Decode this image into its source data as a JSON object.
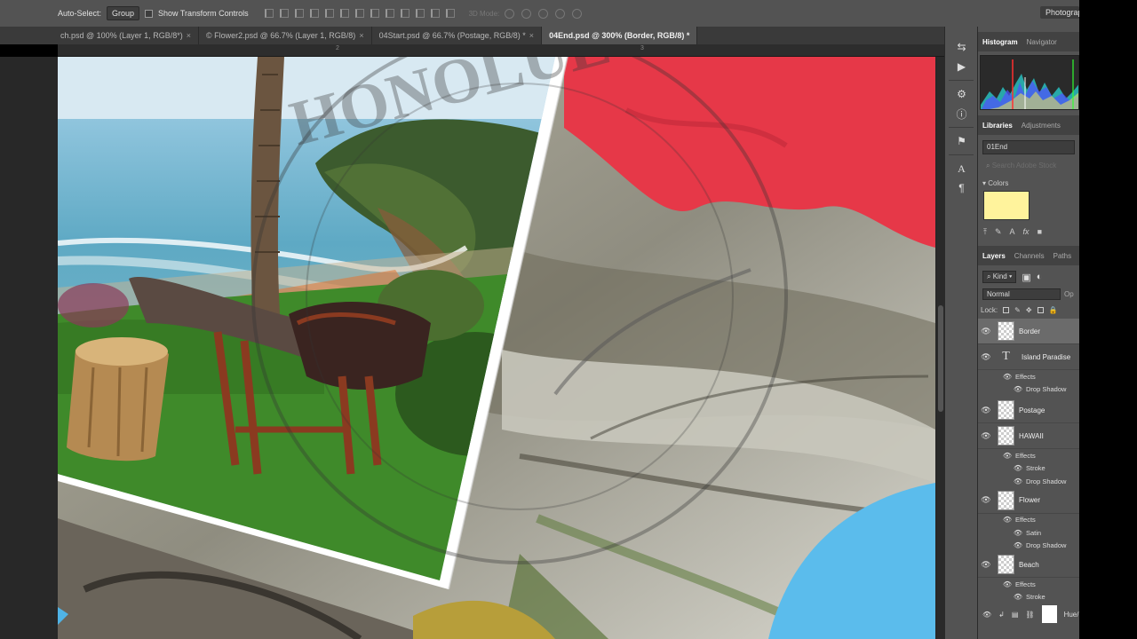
{
  "options_bar": {
    "auto_select_label": "Auto-Select:",
    "auto_select_value": "Group",
    "transform_label": "Show Transform Controls",
    "mode_3d_label": "3D Mode:",
    "workspace": "Photograph"
  },
  "tabs": [
    {
      "label": "ch.psd @ 100% (Layer 1, RGB/8*)",
      "active": false
    },
    {
      "label": "© Flower2.psd @ 66.7% (Layer 1, RGB/8)",
      "active": false
    },
    {
      "label": "04Start.psd @ 66.7% (Postage, RGB/8) *",
      "active": false
    },
    {
      "label": "04End.psd @ 300% (Border, RGB/8) *",
      "active": true
    }
  ],
  "ruler": {
    "mark_1": "2",
    "mark_2": "3"
  },
  "canvas": {
    "stamp_text": "HONOLULU · HAWAII",
    "accent_red": "#e63848",
    "sky_blue": "#5bbcec",
    "grass_green": "#3f8a2a"
  },
  "histogram_panel": {
    "tabs": [
      "Histogram",
      "Navigator"
    ]
  },
  "libraries_panel": {
    "tabs": [
      "Libraries",
      "Adjustments"
    ],
    "library": "01End",
    "search_placeholder": "Search Adobe Stock",
    "colors_label": "Colors",
    "swatch_color": "#fff39c"
  },
  "layers_panel": {
    "tabs": [
      "Layers",
      "Channels",
      "Paths"
    ],
    "filter": "Kind",
    "blend_mode": "Normal",
    "opacity_label": "Op",
    "lock_label": "Lock:",
    "effects_label": "Effects",
    "layers": [
      {
        "name": "Border",
        "type": "pixel",
        "selected": true,
        "effects": []
      },
      {
        "name": "Island Paradise",
        "type": "text",
        "selected": false,
        "effects": [
          "Drop Shadow"
        ]
      },
      {
        "name": "Postage",
        "type": "pixel",
        "selected": false,
        "effects": []
      },
      {
        "name": "HAWAII",
        "type": "pixel",
        "selected": false,
        "effects": [
          "Stroke",
          "Drop Shadow"
        ]
      },
      {
        "name": "Flower",
        "type": "pixel",
        "selected": false,
        "effects": [
          "Satin",
          "Drop Shadow"
        ]
      },
      {
        "name": "Beach",
        "type": "pixel",
        "selected": false,
        "effects": [
          "Stroke"
        ]
      }
    ],
    "bottom_layer": "Hue/"
  }
}
